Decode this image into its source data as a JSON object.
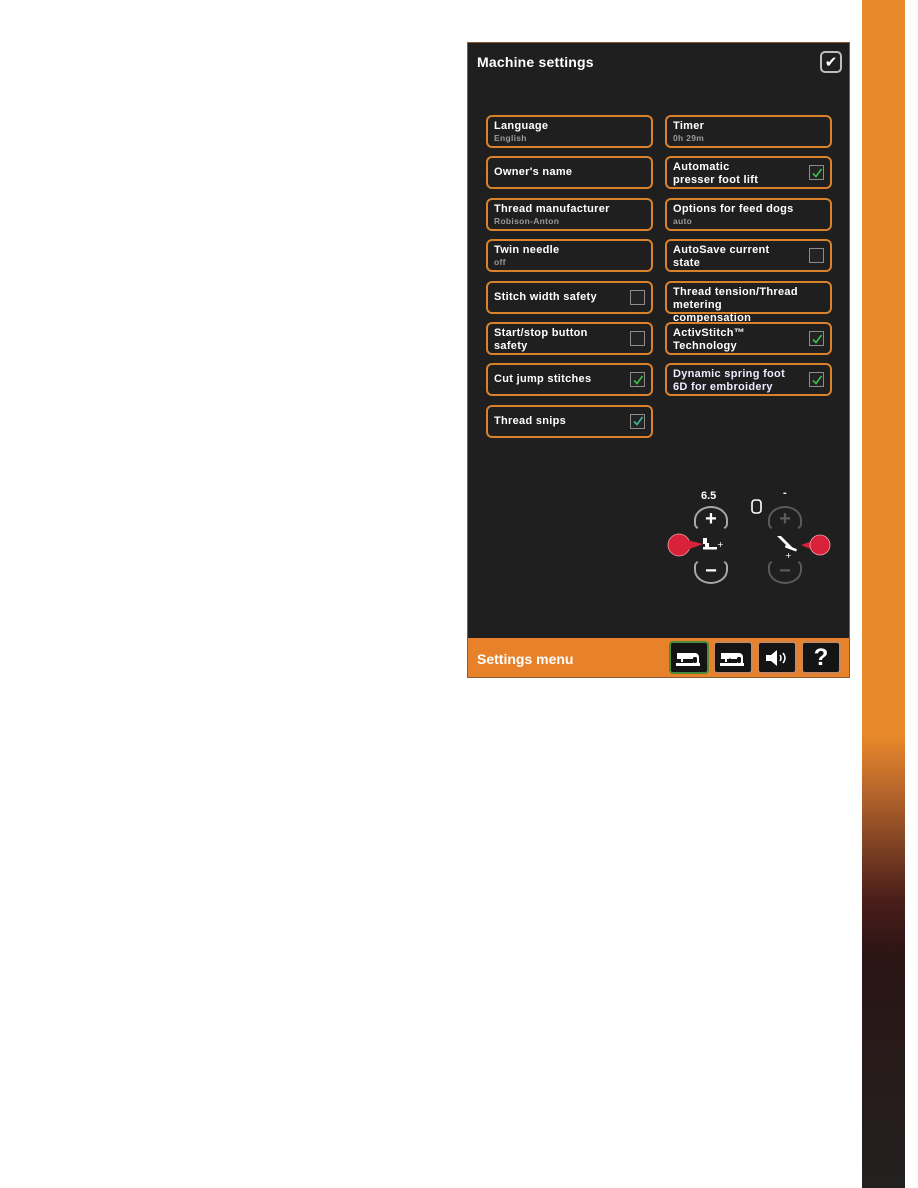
{
  "panel": {
    "title": "Machine settings",
    "confirm_icon": "checkmark-icon"
  },
  "settings_left": [
    {
      "label": "Language",
      "sub": "English",
      "checkbox": null
    },
    {
      "label": "Owner's name",
      "sub": "",
      "checkbox": null
    },
    {
      "label": "Thread manufacturer",
      "sub": "Robison-Anton",
      "checkbox": null
    },
    {
      "label": "Twin needle",
      "sub": "off",
      "checkbox": null
    },
    {
      "label": "Stitch width safety",
      "sub": "",
      "checkbox": false
    },
    {
      "label": "Start/stop button\nsafety",
      "sub": "",
      "checkbox": false
    },
    {
      "label": "Cut jump stitches",
      "sub": "",
      "checkbox": true
    },
    {
      "label": "Thread snips",
      "sub": "",
      "checkbox": true
    }
  ],
  "settings_right": [
    {
      "label": "Timer",
      "sub": "0h 29m",
      "checkbox": null
    },
    {
      "label": "Automatic\npresser foot lift",
      "sub": "",
      "checkbox": true
    },
    {
      "label": "Options for feed dogs",
      "sub": "auto",
      "checkbox": null
    },
    {
      "label": "AutoSave current\nstate",
      "sub": "",
      "checkbox": false
    },
    {
      "label": "Thread tension/Thread\nmetering compensation",
      "sub": "",
      "checkbox": null
    },
    {
      "label": "ActivStitch™\nTechnology",
      "sub": "",
      "checkbox": true
    },
    {
      "label": "Dynamic spring foot\n6D for embroidery",
      "sub": "",
      "checkbox": true
    }
  ],
  "presser_foot_height": {
    "value": "6.5",
    "plus": "+",
    "minus": "−",
    "icon": "presser-foot-height-icon"
  },
  "presser_foot_pressure": {
    "value": "-",
    "plus": "+",
    "minus": "−",
    "icon": "presser-foot-pressure-icon",
    "indicator_icon": "bobbin-icon"
  },
  "bottom_bar": {
    "title": "Settings menu",
    "buttons": [
      {
        "name": "machine-settings",
        "icon": "sewing-machine-icon",
        "active": true
      },
      {
        "name": "embroidery-settings",
        "icon": "embroidery-machine-icon",
        "active": false
      },
      {
        "name": "sound-settings",
        "icon": "speaker-icon",
        "active": false
      },
      {
        "name": "help",
        "icon": "question-icon",
        "label": "?",
        "active": false
      }
    ]
  },
  "colors": {
    "accent_orange": "#e8822a",
    "panel_bg": "#1f1f1f",
    "check_green": "#3dbf4a",
    "pointer_red": "#d9223a"
  }
}
